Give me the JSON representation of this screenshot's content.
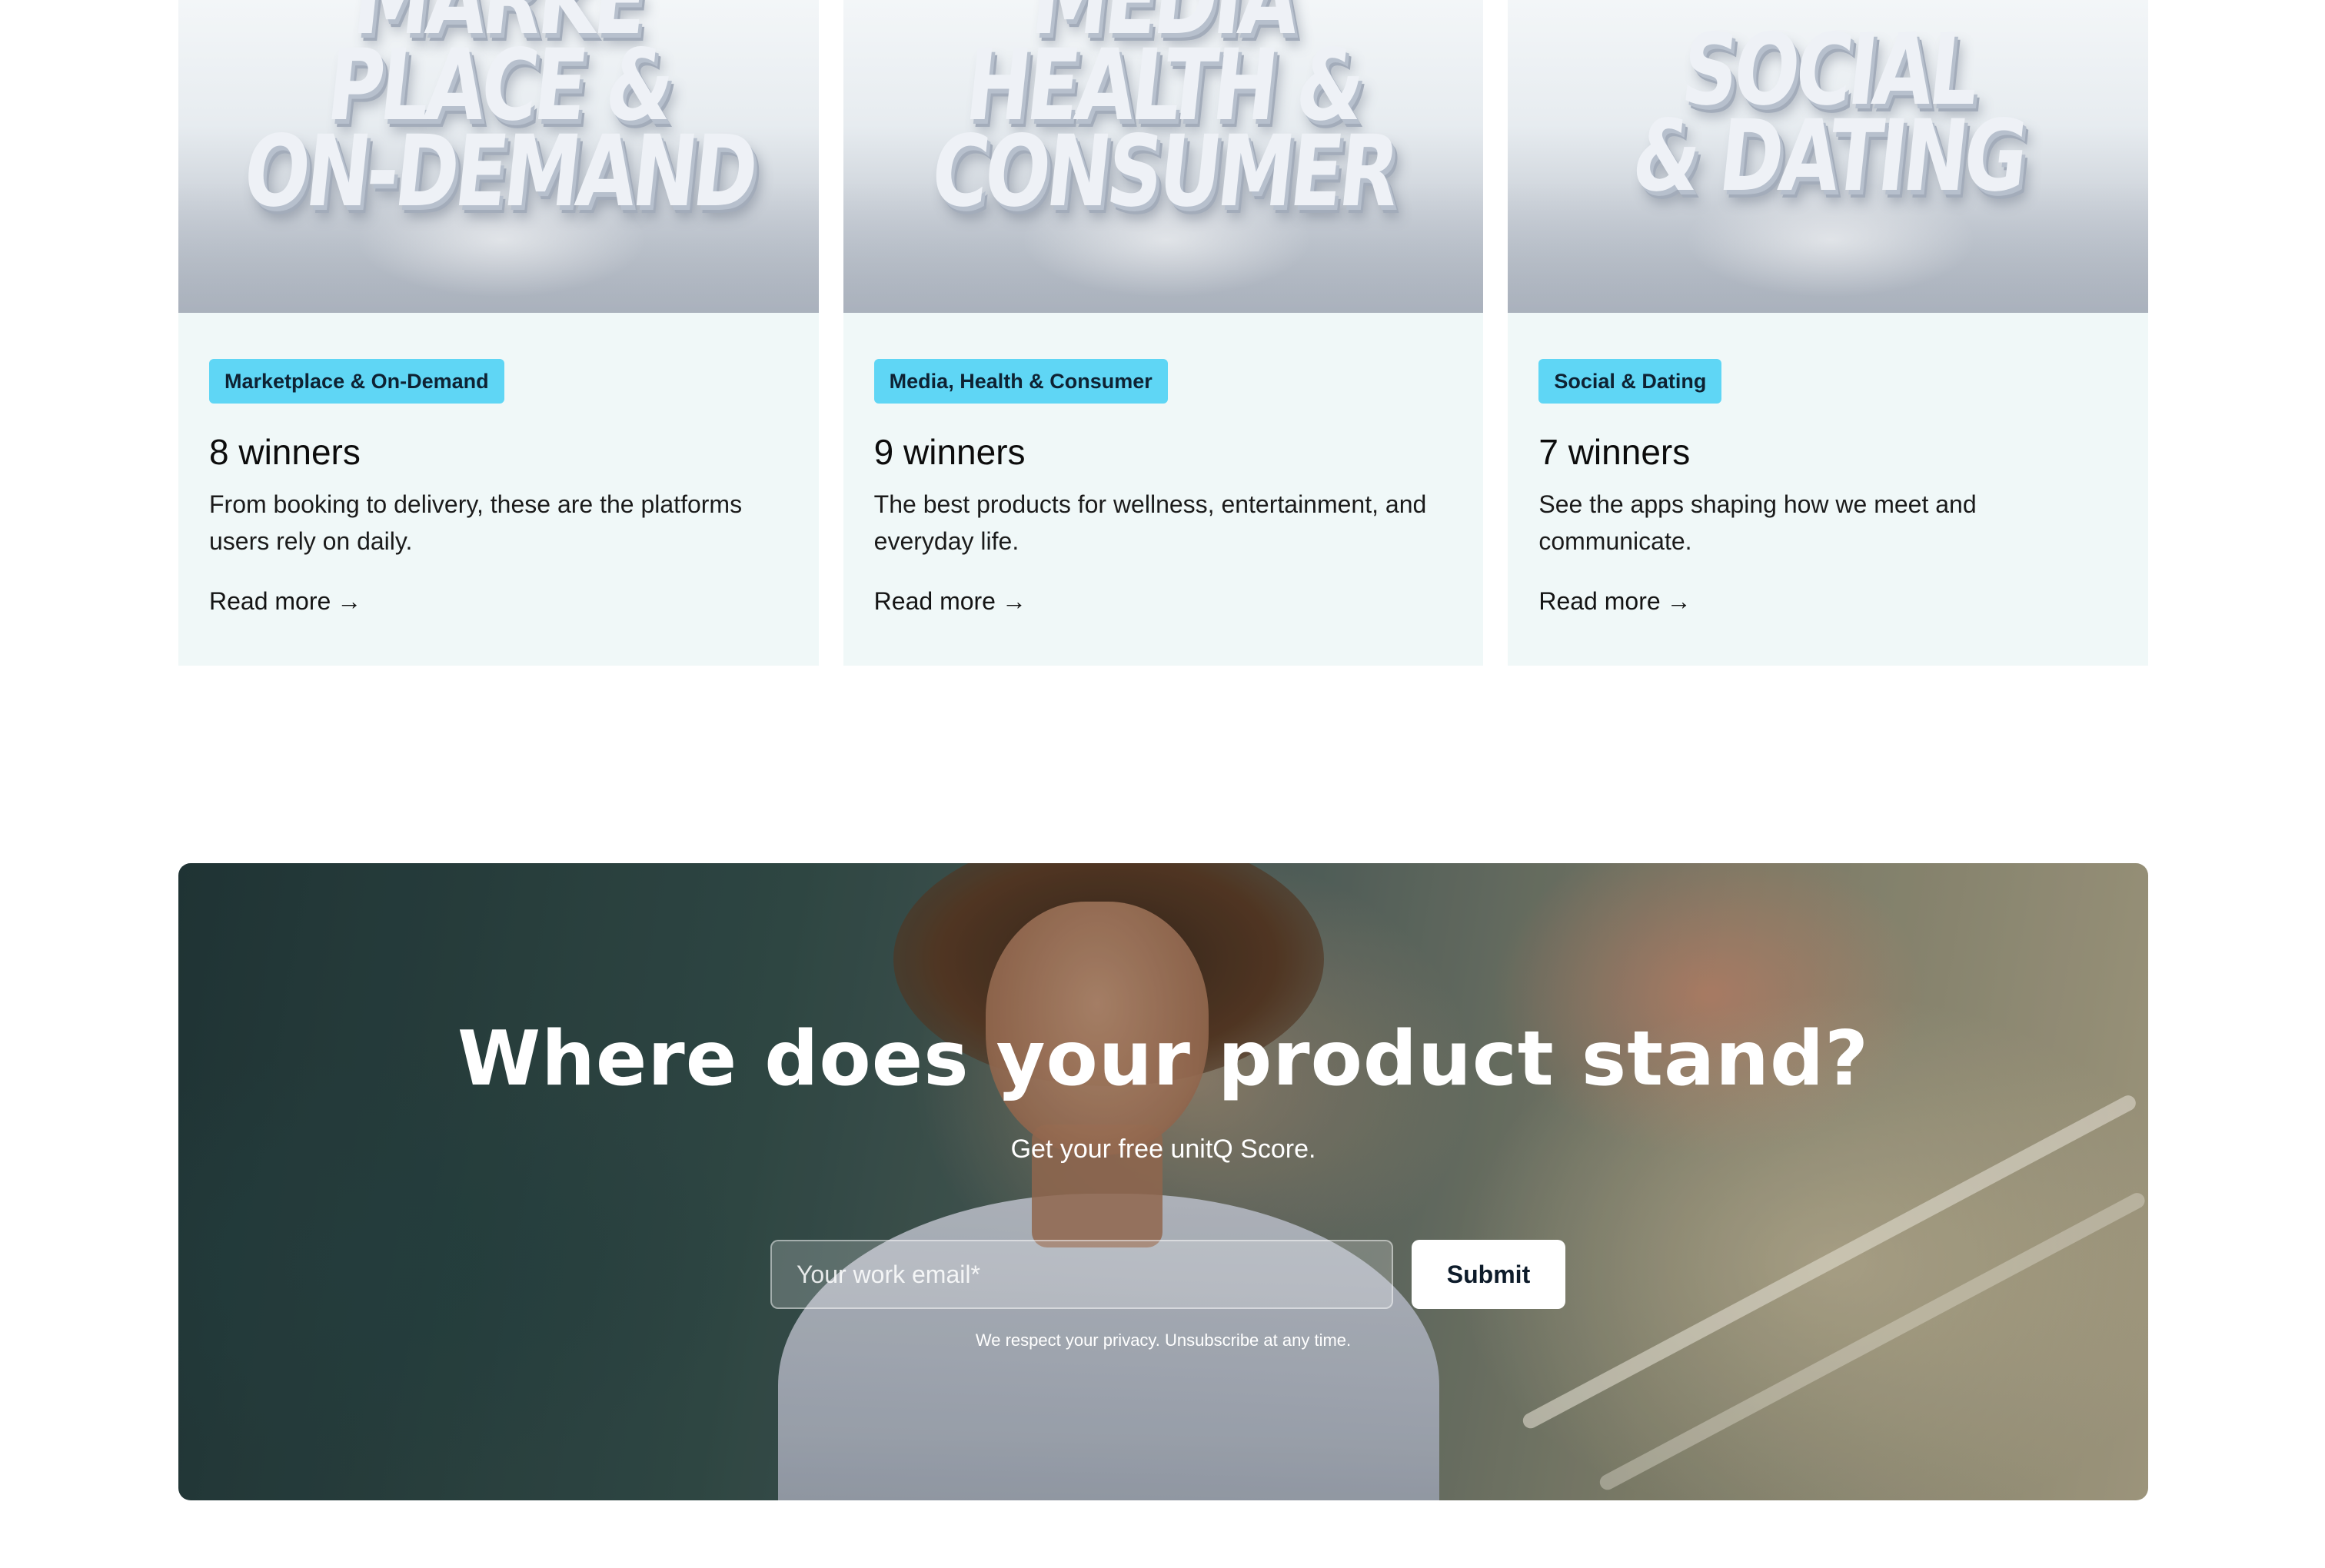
{
  "cards": [
    {
      "image_words": [
        "MARKE",
        "PLACE &",
        "ON-DEMAND"
      ],
      "tag": "Marketplace & On-Demand",
      "winners": "8 winners",
      "description": "From booking to delivery, these are the platforms users rely on daily.",
      "read_more": "Read more",
      "arrow": "→"
    },
    {
      "image_words": [
        "MEDIA",
        "HEALTH &",
        "CONSUMER"
      ],
      "tag": "Media, Health & Consumer",
      "winners": "9 winners",
      "description": "The best products for wellness, entertainment, and everyday life.",
      "read_more": "Read more",
      "arrow": "→"
    },
    {
      "image_words": [
        "SOCIAL",
        "& DATING"
      ],
      "tag": "Social & Dating",
      "winners": "7 winners",
      "description": "See the apps shaping how we meet and communicate.",
      "read_more": "Read more",
      "arrow": "→"
    }
  ],
  "cta": {
    "title": "Where does your product stand?",
    "subtitle": "Get your free unitQ Score.",
    "email_placeholder": "Your work email*",
    "submit_label": "Submit",
    "privacy_note": "We respect your privacy. Unsubscribe at any time."
  },
  "colors": {
    "tag_bg": "#5fd6f5",
    "card_bg": "#f0f8f8",
    "submit_bg": "#ffffff"
  }
}
